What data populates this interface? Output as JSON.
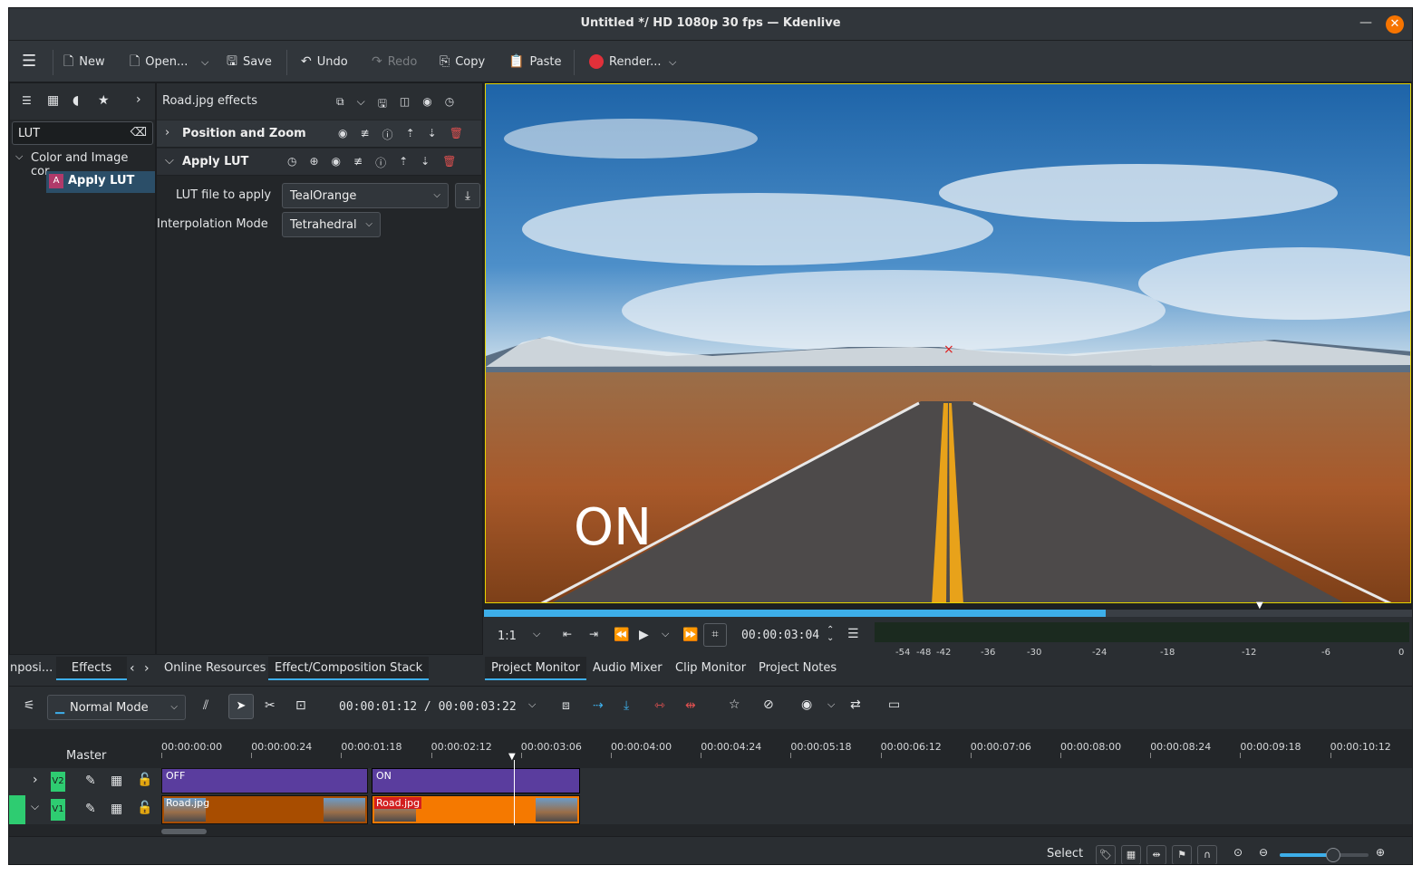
{
  "window": {
    "title": "Untitled */ HD 1080p 30 fps — Kdenlive"
  },
  "toolbar": {
    "new": "New",
    "open": "Open...",
    "save": "Save",
    "undo": "Undo",
    "redo": "Redo",
    "copy": "Copy",
    "paste": "Paste",
    "render": "Render..."
  },
  "effects_list": {
    "search_value": "LUT",
    "category": "Color and Image cor...",
    "item": "Apply LUT",
    "item_badge": "A"
  },
  "effect_stack": {
    "title": "Road.jpg effects",
    "effects": [
      {
        "name": "Position and Zoom",
        "expanded": false
      },
      {
        "name": "Apply LUT",
        "expanded": true
      }
    ],
    "params": {
      "lut_label": "LUT file to apply",
      "lut_value": "TealOrange",
      "interp_label": "Interpolation Mode",
      "interp_value": "Tetrahedral"
    }
  },
  "left_tabs": [
    "nposi...",
    "Effects"
  ],
  "middle_tabs": [
    "Online Resources",
    "Effect/Composition Stack"
  ],
  "monitor": {
    "overlay_text": "ON",
    "zoom": "1:1",
    "timecode": "00:00:03:04",
    "progress": 0.67,
    "tabs": [
      "Project Monitor",
      "Audio Mixer",
      "Clip Monitor",
      "Project Notes"
    ],
    "vu_labels": [
      "-54",
      "-48",
      "-42",
      "-36",
      "-30",
      "-24",
      "-18",
      "-12",
      "-6",
      "0"
    ]
  },
  "timeline": {
    "mode": "Normal Mode",
    "position": "00:00:01:12 / 00:00:03:22",
    "master_label": "Master",
    "ruler": [
      "00:00:00:00",
      "00:00:00:24",
      "00:00:01:18",
      "00:00:02:12",
      "00:00:03:06",
      "00:00:04:00",
      "00:00:04:24",
      "00:00:05:18",
      "00:00:06:12",
      "00:00:07:06",
      "00:00:08:00",
      "00:00:08:24",
      "00:00:09:18",
      "00:00:10:12"
    ],
    "tracks": [
      {
        "label": "V2",
        "clips": [
          "OFF",
          "ON"
        ]
      },
      {
        "label": "V1",
        "clips": [
          "Road.jpg",
          "Road.jpg"
        ]
      }
    ]
  },
  "statusbar": {
    "mode": "Select",
    "zoom_level": 0.6
  },
  "colors": {
    "accent": "#3daee9",
    "render_red": "#e0303a",
    "clip_orange": "#f57900",
    "clip_dark_orange": "#a84d00",
    "clip_purple": "#5a3d9e",
    "track_green": "#2ecc71"
  }
}
